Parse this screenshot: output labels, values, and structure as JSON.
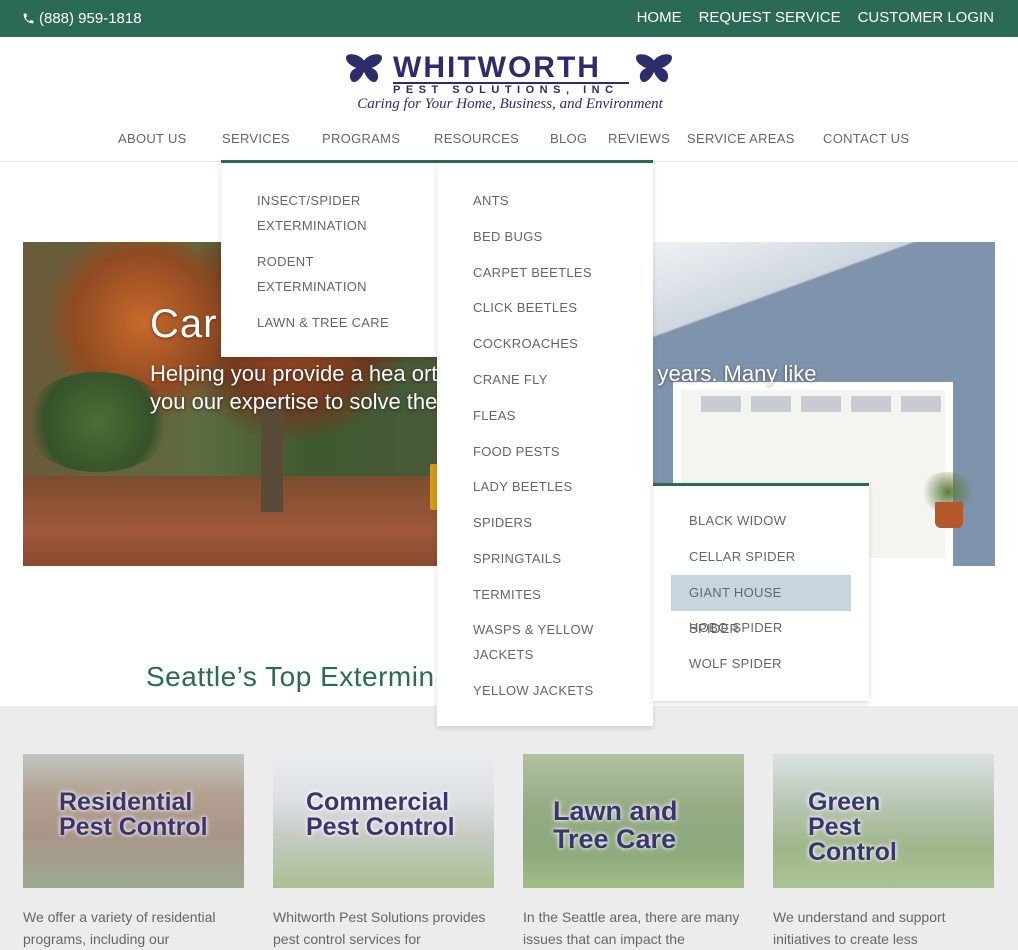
{
  "topbar": {
    "phone": "(888) 959-1818",
    "links": [
      "HOME",
      "REQUEST SERVICE",
      "CUSTOMER LOGIN"
    ]
  },
  "logo": {
    "brand": "WHITWORTH",
    "sub": "PEST SOLUTIONS, INC",
    "tagline": "Caring for Your Home, Business, and Environment"
  },
  "nav": [
    "ABOUT US",
    "SERVICES",
    "PROGRAMS",
    "RESOURCES",
    "BLOG",
    "REVIEWS",
    "SERVICE AREAS",
    "CONTACT US"
  ],
  "services_menu": [
    "INSECT/SPIDER",
    "EXTERMINATION",
    "RODENT",
    "EXTERMINATION",
    "LAWN & TREE CARE"
  ],
  "resources_menu": [
    "ANTS",
    "BED BUGS",
    "CARPET BEETLES",
    "CLICK BEETLES",
    "COCKROACHES",
    "CRANE FLY",
    "FLEAS",
    "FOOD PESTS",
    "LADY BEETLES",
    "SPIDERS",
    "SPRINGTAILS",
    "TERMITES",
    "WASPS & YELLOW",
    "JACKETS",
    "YELLOW JACKETS"
  ],
  "spiders_menu": [
    "BLACK WIDOW",
    "CELLAR SPIDER",
    "GIANT HOUSE SPIDER",
    "HOBO SPIDER",
    "WOLF SPIDER"
  ],
  "hero": {
    "title": "Car",
    "text": "Helping you provide a hea                    ortable home for over 30 years. Many like you                   our expertise to solve their pest control pro                    e."
  },
  "section": {
    "title": "Seattle’s Top Extermin",
    "title_end": "y"
  },
  "cards": [
    {
      "label": "Residential Pest Control",
      "desc": "We offer a variety of residential programs, including our"
    },
    {
      "label": "Commercial Pest Control",
      "desc": "Whitworth Pest Solutions provides pest control services for"
    },
    {
      "label": "Lawn and Tree Care",
      "desc": "In the Seattle area, there are many issues that can impact the"
    },
    {
      "label": "Green Pest Control",
      "desc": "We understand and support initiatives to create less"
    }
  ],
  "colors": {
    "brand_green": "#2b6a56",
    "brand_navy": "#2e2d6b",
    "highlight": "#c7d5e0"
  }
}
